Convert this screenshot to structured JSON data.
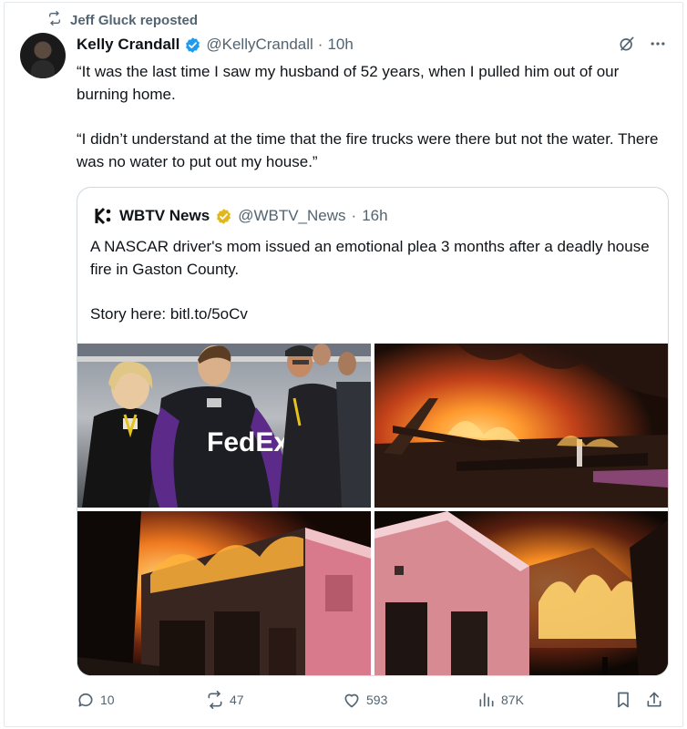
{
  "repost": {
    "icon": "repost-icon",
    "label": "Jeff Gluck reposted"
  },
  "author": {
    "name": "Kelly Crandall",
    "handle": "@KellyCrandall",
    "separator": "·",
    "time": "10h",
    "avatar_icon": "avatar"
  },
  "tweet": {
    "paragraphs": [
      "“It was the last time I saw my husband of 52 years, when I pulled him out of our burning home.",
      "“I didn’t understand at the time that the fire trucks were there but not the water. There was no water to put out my house.”"
    ]
  },
  "quote": {
    "name": "WBTV News",
    "handle": "@WBTV_News",
    "separator": "·",
    "time": "16h",
    "paragraphs": [
      "A NASCAR driver's mom issued an emotional plea 3 months after a deadly house fire in Gaston County.",
      "Story here: bitl.to/5oCv"
    ],
    "photos": [
      "photo-driver-and-mother",
      "photo-fire-night",
      "photo-burning-garage",
      "photo-burning-house"
    ],
    "photo_text": {
      "sponsor": "FedEx"
    }
  },
  "actions": {
    "replies": "10",
    "reposts": "47",
    "likes": "593",
    "views": "87K"
  },
  "colors": {
    "accent": "#1d9bf0",
    "muted": "#536471",
    "gold_badge": "#e2b719"
  }
}
